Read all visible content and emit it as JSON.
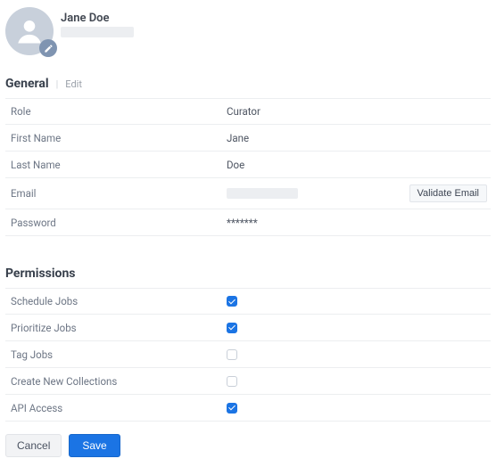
{
  "profile": {
    "name": "Jane Doe"
  },
  "general": {
    "title": "General",
    "editLabel": "Edit",
    "rows": {
      "role": {
        "label": "Role",
        "value": "Curator"
      },
      "firstName": {
        "label": "First Name",
        "value": "Jane"
      },
      "lastName": {
        "label": "Last Name",
        "value": "Doe"
      },
      "email": {
        "label": "Email",
        "validateLabel": "Validate Email"
      },
      "password": {
        "label": "Password",
        "value": "*******"
      }
    }
  },
  "permissions": {
    "title": "Permissions",
    "rows": [
      {
        "label": "Schedule Jobs",
        "checked": true
      },
      {
        "label": "Prioritize Jobs",
        "checked": true
      },
      {
        "label": "Tag Jobs",
        "checked": false
      },
      {
        "label": "Create New Collections",
        "checked": false
      },
      {
        "label": "API Access",
        "checked": true
      }
    ]
  },
  "buttons": {
    "cancel": "Cancel",
    "save": "Save"
  }
}
